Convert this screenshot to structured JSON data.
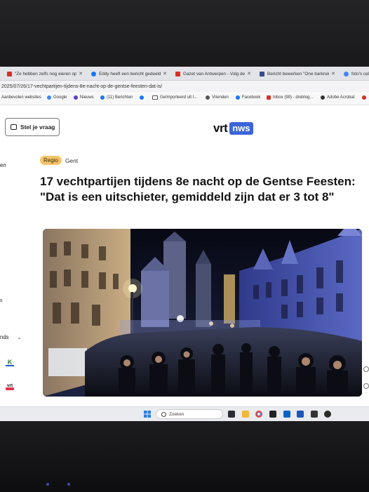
{
  "browser": {
    "tabs": [
      {
        "label": "\"Ze hebben zelfs nog eieren op",
        "favicon_color": "#d93025",
        "active": false
      },
      {
        "label": "Eddy heeft een bericht gedeeld",
        "favicon_color": "#1877f2",
        "active": false
      },
      {
        "label": "Gazet van Antwerpen - Volg de",
        "favicon_color": "#d93025",
        "active": false
      },
      {
        "label": "Bericht bewerken \"One barkruk",
        "favicon_color": "#3a4a8a",
        "active": false
      },
      {
        "label": "foto's cal",
        "favicon_color": "#4285f4",
        "active": false
      }
    ],
    "url": "2025/07/26/17-vechtpartijen-tijdens-8e-nacht-op-de-gentse-feesten-dat-is/",
    "bookmarks": [
      {
        "label": "Aanbevolen websites",
        "icon": "none"
      },
      {
        "label": "Google",
        "icon": "google-icon"
      },
      {
        "label": "Nieuws",
        "icon": "news-icon"
      },
      {
        "label": "(11) Berichten",
        "icon": "facebook-icon"
      },
      {
        "label": "",
        "icon": "facebook-icon"
      },
      {
        "label": "Geïmporteerd uit I...",
        "icon": "folder-icon"
      },
      {
        "label": "Vrienden",
        "icon": "globe-icon"
      },
      {
        "label": "Facebook",
        "icon": "facebook-icon"
      },
      {
        "label": "Inbox (99) - dreblog...",
        "icon": "gmail-icon"
      },
      {
        "label": "Adobe Acrobat",
        "icon": "acrobat-icon"
      }
    ]
  },
  "page": {
    "ask_button": "Stel je vraag",
    "logo_vrt": "vrt",
    "logo_nws": "nws",
    "sidebar_fragments": [
      "en",
      "s",
      "nds",
      "K",
      "vrt"
    ],
    "regio_tag": "Regio",
    "location": "Gent",
    "headline": "17 vechtpartijen tijdens 8e nacht op de Gentse Feesten: \"Dat is een uitschieter, gemiddeld zijn dat er 3 tot 8\"",
    "photo": "night-street-crowd-photo"
  },
  "taskbar": {
    "search_placeholder": "Zoeken",
    "icons": [
      "start-icon",
      "search-icon",
      "taskview-icon",
      "files-icon",
      "folder-icon",
      "chrome-icon",
      "teams-icon",
      "outlook-icon",
      "word-icon",
      "word-icon",
      "photos-icon",
      "whatsapp-icon"
    ]
  },
  "colors": {
    "accent_blue": "#3a64d8",
    "regio_tag": "#f5c46b"
  }
}
